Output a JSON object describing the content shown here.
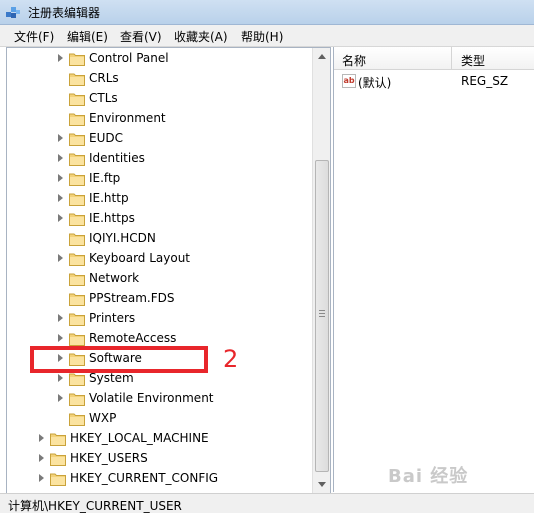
{
  "window": {
    "title": "注册表编辑器",
    "icon": "registry-editor-icon"
  },
  "menu": [
    {
      "label": "文件(F)"
    },
    {
      "label": "编辑(E)"
    },
    {
      "label": "查看(V)"
    },
    {
      "label": "收藏夹(A)"
    },
    {
      "label": "帮助(H)"
    }
  ],
  "tree": {
    "children": [
      {
        "label": "Control Panel",
        "expandable": true
      },
      {
        "label": "CRLs",
        "expandable": false
      },
      {
        "label": "CTLs",
        "expandable": false
      },
      {
        "label": "Environment",
        "expandable": false
      },
      {
        "label": "EUDC",
        "expandable": true
      },
      {
        "label": "Identities",
        "expandable": true
      },
      {
        "label": "IE.ftp",
        "expandable": true
      },
      {
        "label": "IE.http",
        "expandable": true
      },
      {
        "label": "IE.https",
        "expandable": true
      },
      {
        "label": "IQIYI.HCDN",
        "expandable": false
      },
      {
        "label": "Keyboard Layout",
        "expandable": true
      },
      {
        "label": "Network",
        "expandable": false
      },
      {
        "label": "PPStream.FDS",
        "expandable": false
      },
      {
        "label": "Printers",
        "expandable": true
      },
      {
        "label": "RemoteAccess",
        "expandable": true
      },
      {
        "label": "Software",
        "expandable": true
      },
      {
        "label": "System",
        "expandable": true
      },
      {
        "label": "Volatile Environment",
        "expandable": true
      },
      {
        "label": "WXP",
        "expandable": false
      }
    ],
    "hives": [
      {
        "label": "HKEY_LOCAL_MACHINE",
        "expandable": true
      },
      {
        "label": "HKEY_USERS",
        "expandable": true
      },
      {
        "label": "HKEY_CURRENT_CONFIG",
        "expandable": true
      }
    ]
  },
  "values_pane": {
    "columns": {
      "name": "名称",
      "type": "类型"
    },
    "rows": [
      {
        "icon": "string-value-icon",
        "icon_text": "ab",
        "name": "(默认)",
        "type": "REG_SZ"
      }
    ]
  },
  "annotation": {
    "number": "2",
    "color": "#e8262b"
  },
  "status": {
    "path": "计算机\\HKEY_CURRENT_USER"
  },
  "watermark": {
    "text": "Bai 经验"
  }
}
